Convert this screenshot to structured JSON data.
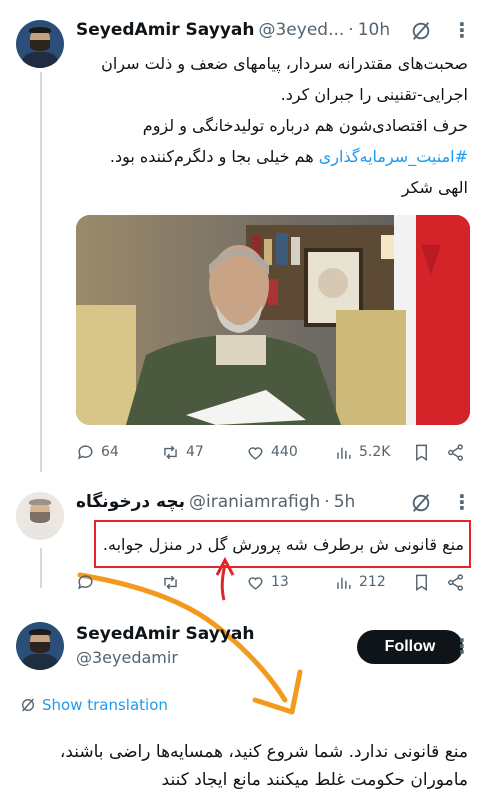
{
  "tweet1": {
    "author_name": "SeyedAmir Sayyah",
    "author_handle": "@3eyed...",
    "time": "10h",
    "lines": [
      "صحبت‌های مقتدرانه سردار، پیامهای ضعف و ذلت سران",
      "اجرایی-تقنینی را جبران کرد.",
      "حرف اقتصادی‌شون هم درباره تولیدخانگی و لزوم",
      "هم خیلی بجا و دلگرم‌کننده بود.",
      "الهی شکر"
    ],
    "hashtag": "#امنیت_سرمایه‌گذاری",
    "stats": {
      "replies": "64",
      "retweets": "47",
      "likes": "440",
      "views": "5.2K"
    }
  },
  "tweet2": {
    "author_name": "بچه درخونگاه",
    "author_handle": "@iraniamrafigh",
    "time": "5h",
    "text": "منع قانونی ش برطرف شه پرورش گل در منزل جوابه.",
    "stats": {
      "retweets": "",
      "likes": "13",
      "views": "212"
    }
  },
  "tweet3": {
    "author_name": "SeyedAmir Sayyah",
    "author_handle": "@3eyedamir",
    "follow_label": "Follow",
    "translation_label": "Show translation",
    "lines": [
      "منع قانونی ندارد. شما شروع کنید، همسایه‌ها راضی باشند،",
      "ماموران حکومت غلط میکنند مانع ایجاد کنند"
    ]
  },
  "colors": {
    "accent": "#1d9bf0",
    "annotation_box": "#e0262b",
    "annotation_arrow": "#f39a1e"
  }
}
